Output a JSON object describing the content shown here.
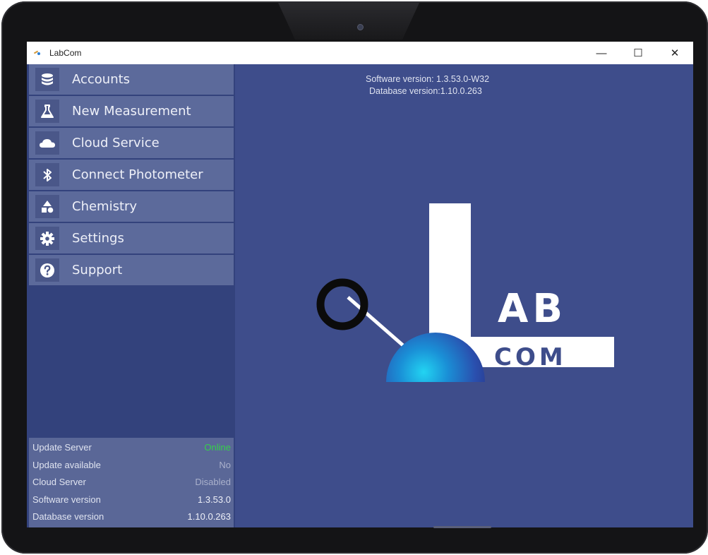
{
  "window": {
    "title": "LabCom",
    "controls": {
      "minimize": "—",
      "maximize": "☐",
      "close": "✕"
    }
  },
  "sidebar": {
    "items": [
      {
        "label": "Accounts",
        "icon": "database-icon"
      },
      {
        "label": "New Measurement",
        "icon": "flask-icon"
      },
      {
        "label": "Cloud Service",
        "icon": "cloud-icon"
      },
      {
        "label": "Connect Photometer",
        "icon": "bluetooth-icon"
      },
      {
        "label": "Chemistry",
        "icon": "shapes-icon"
      },
      {
        "label": "Settings",
        "icon": "gear-icon"
      },
      {
        "label": "Support",
        "icon": "help-icon"
      }
    ]
  },
  "status": {
    "rows": [
      {
        "key": "Update Server",
        "value": "Online"
      },
      {
        "key": "Update available",
        "value": "No"
      },
      {
        "key": "Cloud Server",
        "value": "Disabled"
      },
      {
        "key": "Software version",
        "value": "1.3.53.0"
      },
      {
        "key": "Database version",
        "value": "1.10.0.263"
      }
    ],
    "colors": {
      "online": "#35d04a",
      "muted": "#aab1cc"
    }
  },
  "main": {
    "software_version": "Software version:  1.3.53.0-W32",
    "database_version": "Database version:1.10.0.263",
    "logo": {
      "big_text": "AB",
      "small_text": "COM"
    }
  },
  "colors": {
    "sidebar_bg": "#33427c",
    "nav_item_bg": "#5c6a9b",
    "main_bg": "#3e4d8b"
  }
}
